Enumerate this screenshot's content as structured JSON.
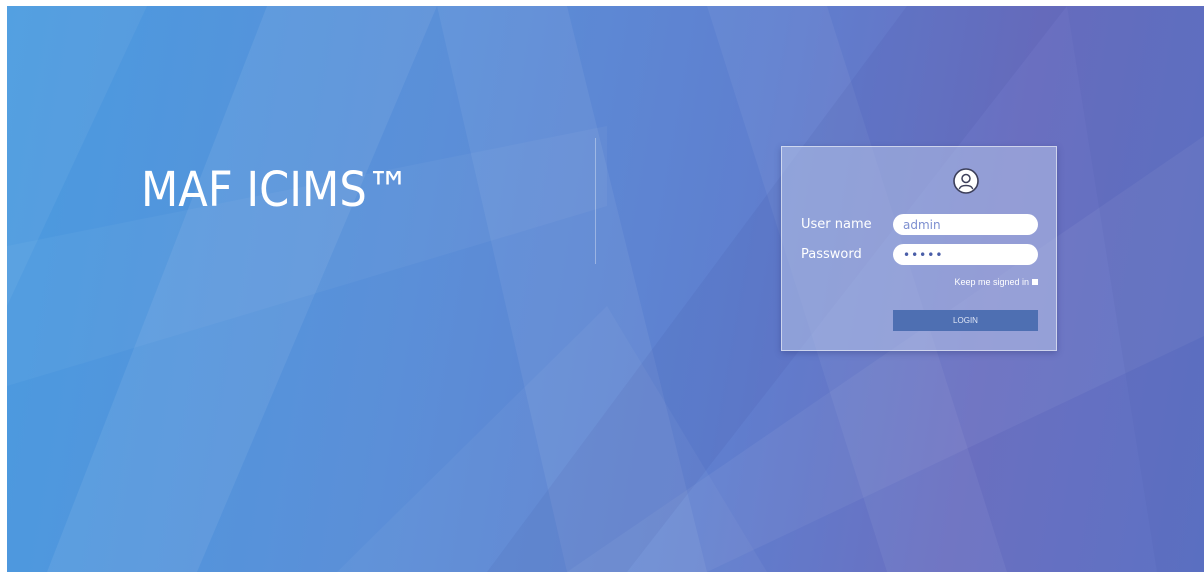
{
  "app": {
    "title": "MAF ICIMS™"
  },
  "login": {
    "avatar_icon": "user-circle-icon",
    "username_label": "User name",
    "username_value": "admin",
    "password_label": "Password",
    "password_value": "admin",
    "keep_signed_label": "Keep me signed in",
    "keep_signed_checked": false,
    "submit_label": "LOGIN"
  },
  "colors": {
    "background_left": "#4a9be0",
    "background_right": "#6a6fc0",
    "panel": "#b7c3e8",
    "button": "#4e6fb2",
    "text": "#ffffff"
  }
}
